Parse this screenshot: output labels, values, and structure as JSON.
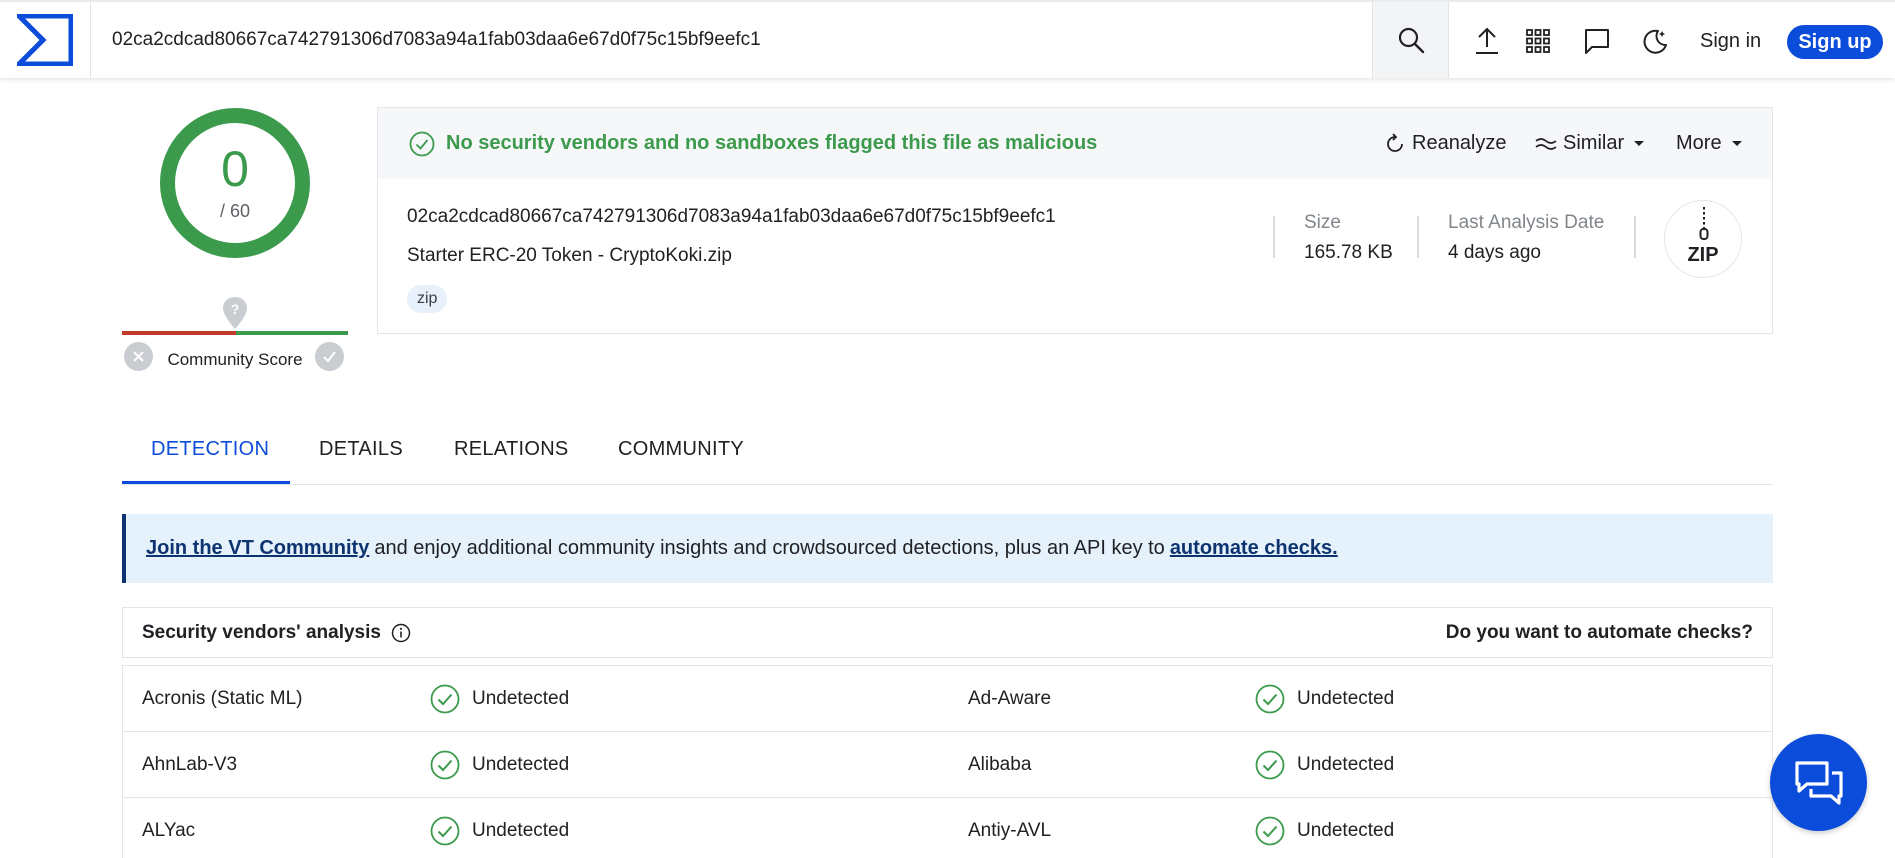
{
  "header": {
    "search_value": "02ca2cdcad80667ca742791306d7083a94a1fab03daa6e67d0f75c15bf9eefc1",
    "sign_in": "Sign in",
    "sign_up": "Sign up"
  },
  "score": {
    "detections": "0",
    "total": "/ 60",
    "community_label": "Community Score"
  },
  "file": {
    "status": "No security vendors and no sandboxes flagged this file as malicious",
    "actions": {
      "reanalyze": "Reanalyze",
      "similar": "Similar",
      "more": "More"
    },
    "hash": "02ca2cdcad80667ca742791306d7083a94a1fab03daa6e67d0f75c15bf9eefc1",
    "name": "Starter ERC-20 Token - CryptoKoki.zip",
    "tag": "zip",
    "size_label": "Size",
    "size_value": "165.78 KB",
    "date_label": "Last Analysis Date",
    "date_value": "4 days ago",
    "type_icon_label": "ZIP"
  },
  "tabs": [
    "DETECTION",
    "DETAILS",
    "RELATIONS",
    "COMMUNITY"
  ],
  "banner": {
    "link1": "Join the VT Community",
    "text": "and enjoy additional community insights and crowdsourced detections, plus an API key to",
    "link2": "automate checks."
  },
  "vendors": {
    "title": "Security vendors' analysis",
    "automate_prompt": "Do you want to automate checks?",
    "rows": [
      {
        "left_name": "Acronis (Static ML)",
        "left_result": "Undetected",
        "right_name": "Ad-Aware",
        "right_result": "Undetected"
      },
      {
        "left_name": "AhnLab-V3",
        "left_result": "Undetected",
        "right_name": "Alibaba",
        "right_result": "Undetected"
      },
      {
        "left_name": "ALYac",
        "left_result": "Undetected",
        "right_name": "Antiy-AVL",
        "right_result": "Undetected"
      }
    ]
  },
  "colors": {
    "accent": "#0b4dda",
    "clean": "#3c9a4c",
    "banner_bg": "#e5f1fb",
    "banner_link": "#0d3470"
  }
}
